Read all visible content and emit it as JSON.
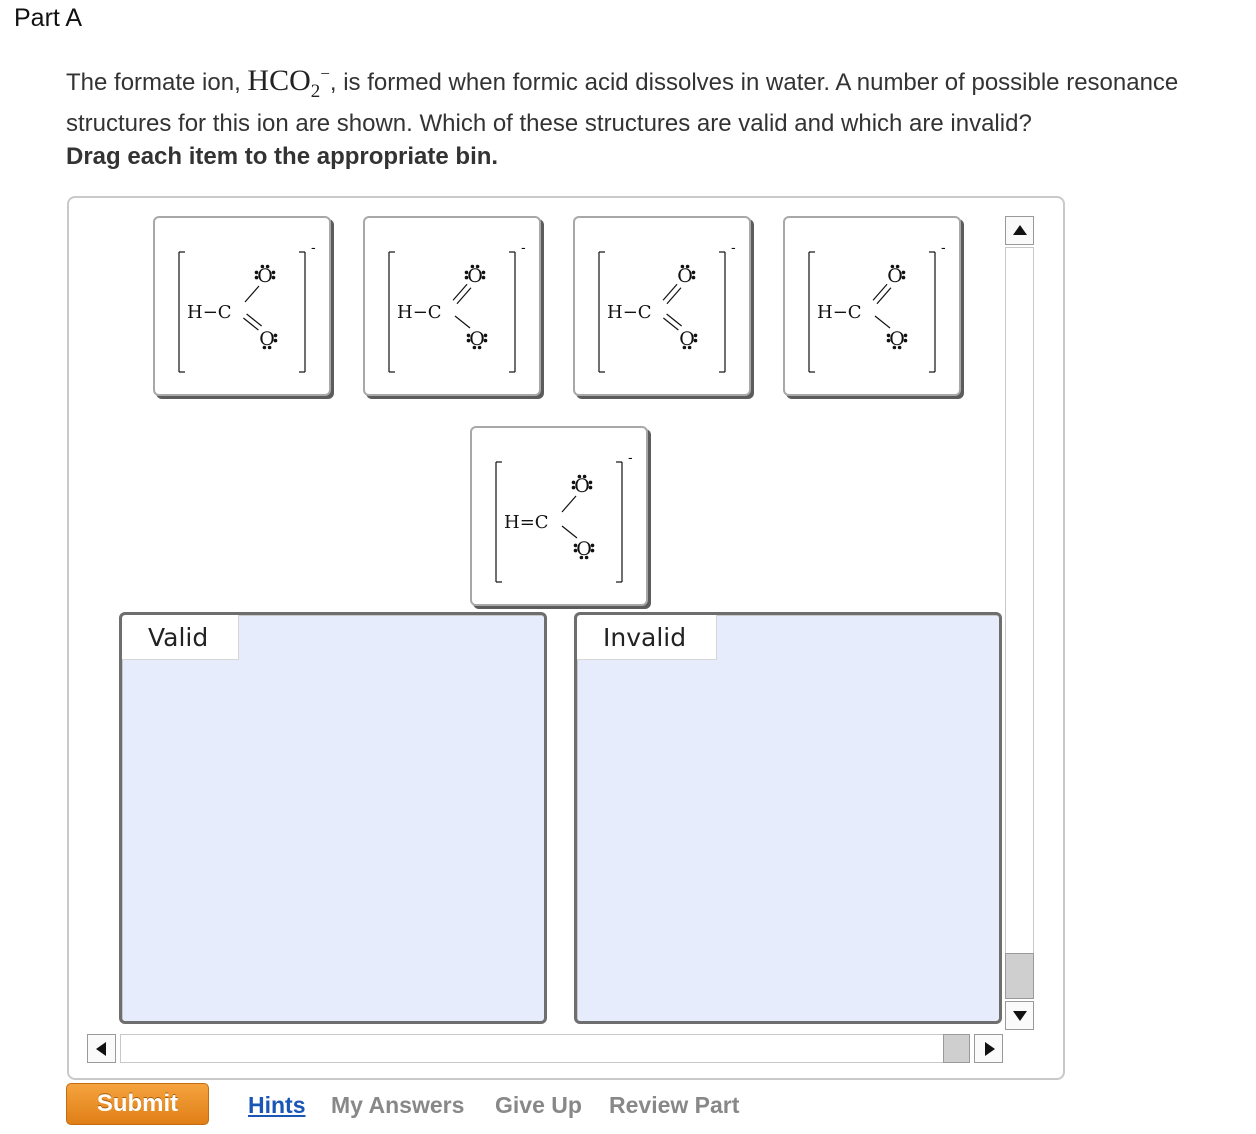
{
  "part": {
    "title": "Part A"
  },
  "question": {
    "text_before": "The formate ion, ",
    "formula_main": "HCO",
    "formula_sub": "2",
    "formula_sup": "−",
    "text_after": ", is formed when formic acid dissolves in water. A number of possible resonance structures for this ion are shown. Which of these structures are valid and which are invalid?",
    "instruction": "Drag each item to the appropriate bin."
  },
  "tiles": [
    {
      "id": "structure-1",
      "h_bond": "H−C",
      "charge": "-",
      "upper_bond": "single",
      "lower_bond": "double",
      "upper_o_lone_pairs": 3,
      "lower_o_lone_pairs": 2,
      "upper_o_label": "O",
      "lower_o_label": "O"
    },
    {
      "id": "structure-2",
      "h_bond": "H−C",
      "charge": "-",
      "upper_bond": "double",
      "lower_bond": "single",
      "upper_o_lone_pairs": 3,
      "lower_o_lone_pairs": 3,
      "upper_o_label": "O",
      "lower_o_label": "O"
    },
    {
      "id": "structure-3",
      "h_bond": "H−C",
      "charge": "-",
      "upper_bond": "double",
      "lower_bond": "double",
      "upper_o_lone_pairs": 2,
      "lower_o_lone_pairs": 2,
      "upper_o_label": "O",
      "lower_o_label": "O"
    },
    {
      "id": "structure-4",
      "h_bond": "H−C",
      "charge": "-",
      "upper_bond": "double",
      "lower_bond": "single",
      "upper_o_lone_pairs": 2,
      "lower_o_lone_pairs": 3,
      "upper_o_label": "O",
      "lower_o_label": "O"
    },
    {
      "id": "structure-5",
      "h_bond": "H=C",
      "charge": "-",
      "upper_bond": "single",
      "lower_bond": "single",
      "upper_o_lone_pairs": 3,
      "lower_o_lone_pairs": 3,
      "upper_o_label": "O",
      "lower_o_label": "O"
    }
  ],
  "bins": {
    "valid_label": "Valid",
    "invalid_label": "Invalid"
  },
  "actions": {
    "submit_label": "Submit",
    "hints_label": "Hints",
    "my_answers_label": "My Answers",
    "give_up_label": "Give Up",
    "review_part_label": "Review Part"
  },
  "colors": {
    "submit": "#e8891f",
    "bin_fill": "#e6ecfb",
    "link_active": "#1a56b5",
    "link_inactive": "#888888"
  }
}
